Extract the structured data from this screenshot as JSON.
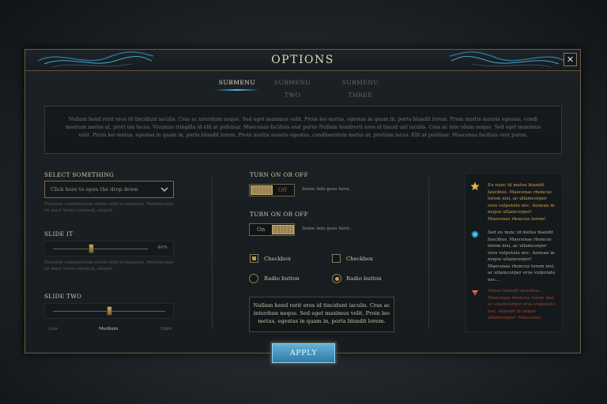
{
  "dialog": {
    "title": "Options",
    "close_label": "✕"
  },
  "tabs": [
    {
      "label": "SUBMENU",
      "active": true
    },
    {
      "label": "SUBMENU TWO",
      "active": false
    },
    {
      "label": "SUBMENU THREE",
      "active": false
    }
  ],
  "info_text": "Nullam hend rerit eros id tincidunt iaculis. Cras ac interdum neque. Sed eget maximus velit. Proin leo metus, egestas in quam in, porta blandit lorem. Proin mattis mauris egestas, condi mentum metus at, proti um lacus. Vivamus tringilla id elit at pulvinar. Maecenas facilisis erat purus Nullam hendrerit eros id tincid unt iaculis. Cras ac inte rdum neque. Sed eget maximus velit. Proin leo metus, egestas in quam in, porta blandit lorem. Proin mattis mauris egestas, condimentum metus at, pretium lacus. Elit at pulvinar. Maecenas facilisis erat purus.",
  "left": {
    "select": {
      "label": "SELECT SOMETHING",
      "value": "Click here to open the drop down",
      "hint": "Praesent condimentum mollis nibh at maximus. Pellentesque sit amet lectus euismod, aliquet..."
    },
    "slide_it": {
      "label": "SLIDE IT",
      "value_text": "40%",
      "value": 0.4,
      "hint": "Praesent condimentum mollis nibh at maximus. Pellentesque sit amet lectus euismod, aliquet..."
    },
    "slide_two": {
      "label": "SLIDE TWO",
      "value": 0.5,
      "low": "Low",
      "medium": "Medium",
      "high": "High"
    }
  },
  "middle": {
    "toggle1": {
      "label": "TURN ON OR OFF",
      "state": "Off",
      "info": "Some info goes here."
    },
    "toggle2": {
      "label": "TURN ON OR OFF",
      "state": "On",
      "info": "Some info goes here."
    },
    "checkbox1": {
      "label": "Checkbox",
      "checked": true
    },
    "checkbox2": {
      "label": "Checkbox",
      "checked": false
    },
    "radio1": {
      "label": "Radio button",
      "selected": false
    },
    "radio2": {
      "label": "Radio button",
      "selected": true
    },
    "description": "Nullam hend rerit eros id tincidunt iaculis. Cras ac interdum neque. Sed eget maximus velit. Proin leo metus, egestas in quam in, porta blandit lorem."
  },
  "news": [
    {
      "icon": "star-icon",
      "text": "Eu nunc id metus blandit faucibus. Maecenas rhoncus lorem nisi, ac ullamcorper eros vulputate nec. Aenean in neque ullamcorper! Maecenas rhoncus lorem!",
      "color": "#d5a24a"
    },
    {
      "icon": "blue-orb-icon",
      "text": "Sed eu nunc id metus blandit faucibus. Maecenas rhoncus lorem nisi, ac ullamcorper eros vulputate nec. Aenean in neque ullamcorper! Maecenas rhoncus lorem nisi, ac ullamcorper eros vulputate nec...",
      "color": "#b7ad96"
    },
    {
      "icon": "red-gem-icon",
      "text": "Metus blandit faucibus. Maecenas rhoncus lorem nisi, ac ullamcorper eros vulputate nec. Aenean in neque ullamcorper! Maecenas.",
      "color": "#a8442c"
    }
  ],
  "apply_label": "APPLY",
  "colors": {
    "accent": "#56b8e0",
    "gold": "#b8974e",
    "border": "#6a5d42"
  }
}
